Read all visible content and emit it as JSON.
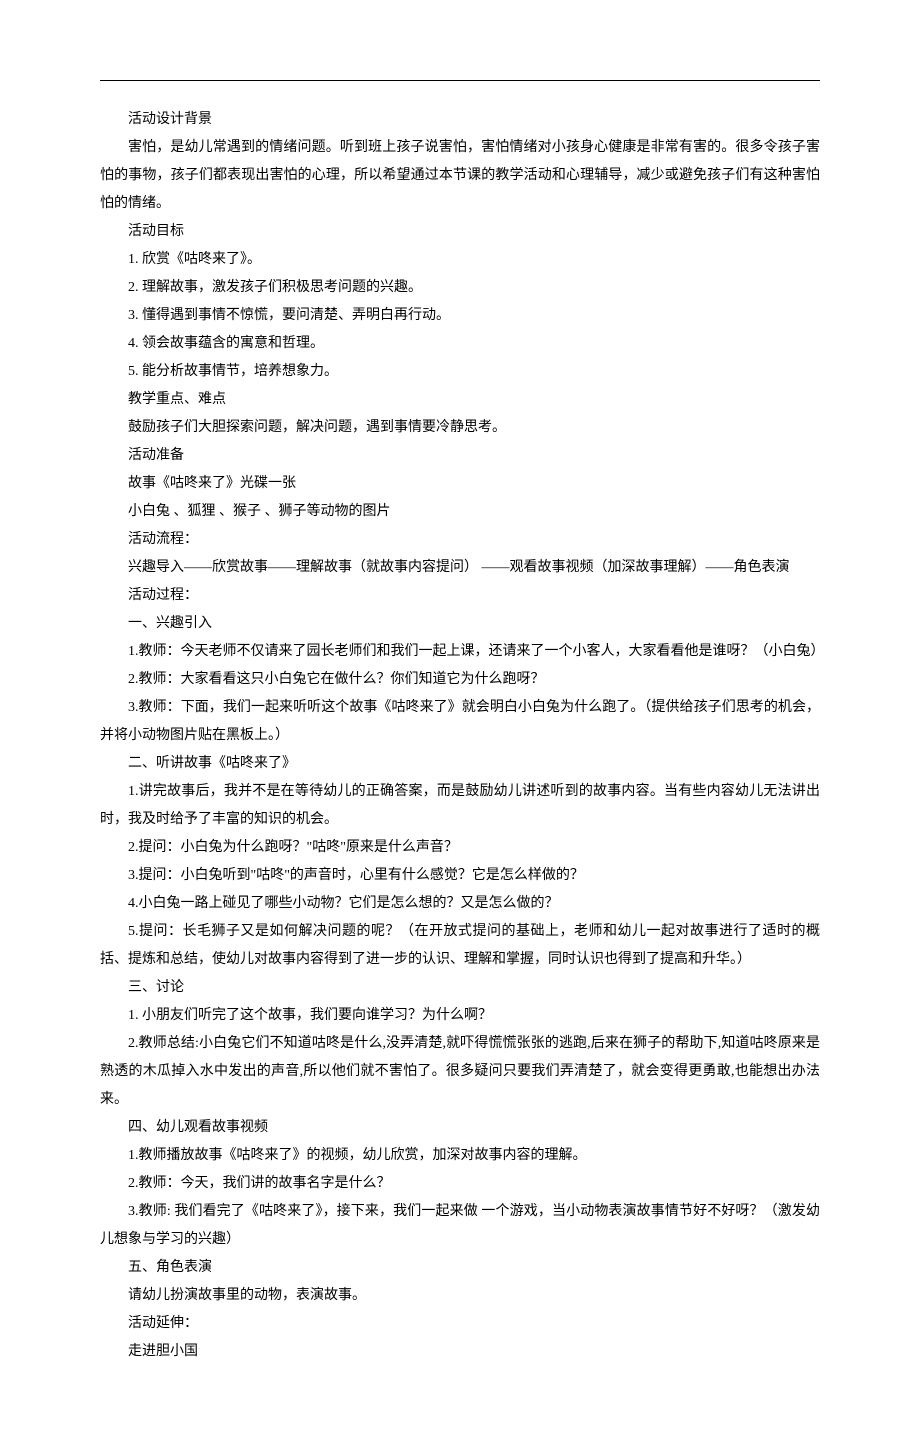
{
  "paragraphs": [
    "活动设计背景",
    "害怕，是幼儿常遇到的情绪问题。听到班上孩子说害怕，害怕情绪对小孩身心健康是非常有害的。很多令孩子害怕的事物，孩子们都表现出害怕的心理，所以希望通过本节课的教学活动和心理辅导，减少或避免孩子们有这种害怕怕的情绪。",
    "活动目标",
    "1. 欣赏《咕咚来了》。",
    "2. 理解故事，激发孩子们积极思考问题的兴趣。",
    "3. 懂得遇到事情不惊慌，要问清楚、弄明白再行动。",
    "4. 领会故事蕴含的寓意和哲理。",
    "5. 能分析故事情节，培养想象力。",
    "教学重点、难点",
    "鼓励孩子们大胆探索问题，解决问题，遇到事情要冷静思考。",
    "活动准备",
    "故事《咕咚来了》光碟一张",
    "小白兔 、狐狸 、猴子 、狮子等动物的图片",
    "活动流程：",
    "兴趣导入——欣赏故事——理解故事（就故事内容提问） ——观看故事视频（加深故事理解）——角色表演",
    "活动过程：",
    "一、兴趣引入",
    "1.教师：今天老师不仅请来了园长老师们和我们一起上课，还请来了一个小客人，大家看看他是谁呀？（小白兔）",
    "2.教师：大家看看这只小白兔它在做什么？你们知道它为什么跑呀？",
    "3.教师：下面，我们一起来听听这个故事《咕咚来了》就会明白小白兔为什么跑了。（提供给孩子们思考的机会，并将小动物图片贴在黑板上。）",
    "二、听讲故事《咕咚来了》",
    "1.讲完故事后，我并不是在等待幼儿的正确答案，而是鼓励幼儿讲述听到的故事内容。当有些内容幼儿无法讲出时，我及时给予了丰富的知识的机会。",
    "2.提问：小白兔为什么跑呀？\"咕咚\"原来是什么声音？",
    "3.提问：小白兔听到\"咕咚\"的声音时，心里有什么感觉？它是怎么样做的？",
    "4.小白兔一路上碰见了哪些小动物？它们是怎么想的？又是怎么做的？",
    "5.提问：长毛狮子又是如何解决问题的呢？（在开放式提问的基础上，老师和幼儿一起对故事进行了适时的概括、提炼和总结，使幼儿对故事内容得到了进一步的认识、理解和掌握，同时认识也得到了提高和升华。）",
    "三、讨论",
    "1. 小朋友们听完了这个故事，我们要向谁学习？为什么啊？",
    "2.教师总结:小白兔它们不知道咕咚是什么,没弄清楚,就吓得慌慌张张的逃跑,后来在狮子的帮助下,知道咕咚原来是熟透的木瓜掉入水中发出的声音,所以他们就不害怕了。很多疑问只要我们弄清楚了，就会变得更勇敢,也能想出办法来。",
    "四、幼儿观看故事视频",
    "1.教师播放故事《咕咚来了》的视频，幼儿欣赏，加深对故事内容的理解。",
    "2.教师：今天，我们讲的故事名字是什么？",
    "3.教师: 我们看完了《咕咚来了》，接下来，我们一起来做 一个游戏，当小动物表演故事情节好不好呀？（激发幼儿想象与学习的兴趣）",
    "五、角色表演",
    "请幼儿扮演故事里的动物，表演故事。",
    "活动延伸：",
    "走进胆小国"
  ]
}
